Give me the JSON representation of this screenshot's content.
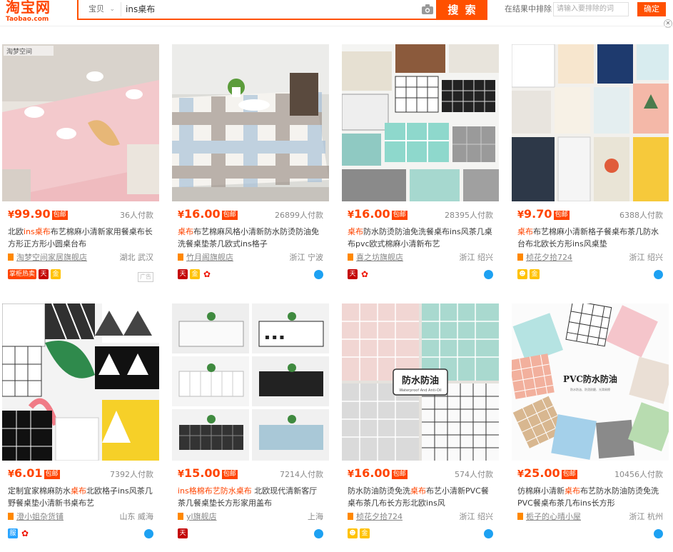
{
  "header": {
    "logo_main": "淘宝网",
    "logo_sub": "Taobao.com",
    "scope": "宝贝",
    "search_value": "ins桌布",
    "search_button": "搜 索",
    "exclude_label": "在结果中排除",
    "exclude_placeholder": "请输入要排除的词",
    "confirm_button": "确定"
  },
  "products": [
    {
      "price": "99.90",
      "yen": "¥",
      "baoyou": "包邮",
      "paid": "36人付款",
      "title_parts": [
        "北欧",
        "ins",
        "桌布",
        "布艺棉麻小清新家用餐桌布长方形正方形小圆桌台布"
      ],
      "shop": "淘梦空间家居旗舰店",
      "location": "湖北 武汉",
      "badges": [
        "掌柜热卖",
        "天",
        "金"
      ],
      "ad": "广告",
      "drop": false
    },
    {
      "price": "16.00",
      "yen": "¥",
      "baoyou": "包邮",
      "paid": "26899人付款",
      "title_parts": [
        "",
        "",
        "桌布",
        "布艺棉麻风格小清新防水防烫防油免洗餐桌垫茶几欧式ins格子"
      ],
      "shop": "竹月阁旗舰店",
      "location": "浙江 宁波",
      "badges": [
        "天",
        "金",
        "花"
      ],
      "drop": true
    },
    {
      "price": "16.00",
      "yen": "¥",
      "baoyou": "包邮",
      "paid": "28395人付款",
      "title_parts": [
        "",
        "",
        "桌布",
        "防水防烫防油免洗餐桌布ins风茶几桌布pvc欧式棉麻小清新布艺"
      ],
      "shop": "喜之坊旗舰店",
      "location": "浙江 绍兴",
      "badges": [
        "天",
        "花"
      ],
      "drop": true
    },
    {
      "price": "9.70",
      "yen": "¥",
      "baoyou": "包邮",
      "paid": "6388人付款",
      "title_parts": [
        "",
        "",
        "桌布",
        "布艺棉麻小清新格子餐桌布茶几防水台布北欧长方形ins风桌垫"
      ],
      "shop": "桢花夕拾724",
      "location": "浙江 绍兴",
      "badges": [
        "金",
        "金"
      ],
      "drop": true
    },
    {
      "price": "6.01",
      "yen": "¥",
      "baoyou": "包邮",
      "paid": "7392人付款",
      "title_parts": [
        "定制宜家棉麻防水",
        "",
        "桌布",
        "北欧格子ins风茶几野餐桌垫小清新书桌布艺"
      ],
      "shop": "澄小姐杂货铺",
      "location": "山东 威海",
      "badges": [
        "蓝",
        "花"
      ],
      "drop": true
    },
    {
      "price": "15.00",
      "yen": "¥",
      "baoyou": "包邮",
      "paid": "7214人付款",
      "title_parts": [
        "",
        "ins",
        "格棉布艺防水桌布",
        " 北欧现代清新客厅茶几餐桌垫长方形家用盖布"
      ],
      "shop": "yl旗舰店",
      "location": "上海",
      "badges": [
        "天"
      ],
      "drop": true
    },
    {
      "price": "16.00",
      "yen": "¥",
      "baoyou": "包邮",
      "paid": "574人付款",
      "title_parts": [
        "防水防油防烫免洗",
        "",
        "桌布",
        "布艺小清新PVC餐桌布茶几布长方形北欧ins风"
      ],
      "shop": "桢花夕拾724",
      "location": "浙江 绍兴",
      "badges": [
        "金",
        "金"
      ],
      "drop": true
    },
    {
      "price": "25.00",
      "yen": "¥",
      "baoyou": "包邮",
      "paid": "10456人付款",
      "title_parts": [
        "仿棉麻小清新",
        "",
        "桌布",
        "布艺防水防油防烫免洗PVC餐桌布茶几布ins长方形"
      ],
      "shop": "栀子的心晴小屋",
      "location": "浙江 杭州",
      "badges": [],
      "drop": true
    }
  ],
  "image_text": {
    "brand_watermark": "淘梦空间",
    "p7_label": "防水防油",
    "p7_sub": "Waterproof And Anti-Oil",
    "p8_label": "PVC防水防油",
    "p8_sub": "防水防油、防烫耐磨、光滑易擦"
  },
  "colors": {
    "accent": "#ff5000",
    "price": "#ff4400",
    "tm": "#c40000",
    "drop": "#1da1f2"
  }
}
